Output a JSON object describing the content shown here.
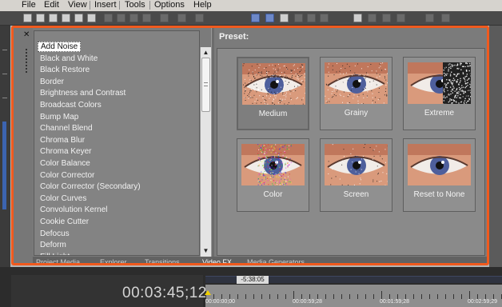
{
  "menu": [
    "File",
    "Edit",
    "View",
    "Insert",
    "Tools",
    "Options",
    "Help"
  ],
  "effects": [
    "Add Noise",
    "Black and White",
    "Black Restore",
    "Border",
    "Brightness and Contrast",
    "Broadcast Colors",
    "Bump Map",
    "Channel Blend",
    "Chroma Blur",
    "Chroma Keyer",
    "Color Balance",
    "Color Corrector",
    "Color Corrector (Secondary)",
    "Color Curves",
    "Convolution Kernel",
    "Cookie Cutter",
    "Defocus",
    "Deform",
    "Fill Light"
  ],
  "selected_effect": "Add Noise",
  "preset_title": "Preset:",
  "presets": [
    "Medium",
    "Grainy",
    "Extreme",
    "Color",
    "Screen",
    "Reset to None"
  ],
  "selected_preset": "Medium",
  "tabs": [
    "Project Media",
    "Explorer",
    "Transitions",
    "Video FX",
    "Media Generators"
  ],
  "active_tab": "Video FX",
  "timeline": {
    "timecode": "00:03:45;12",
    "region_marker": "-5:38:05",
    "ruler_labels": [
      "00:00:00;00",
      "00:00:59;28",
      "00:01:59;28",
      "00:02:59;29"
    ]
  },
  "colors": {
    "highlight": "#f05a1e",
    "panel": "#7b7b7b"
  },
  "icons": [
    "close-icon",
    "scroll-up-icon",
    "scroll-down-icon",
    "playhead-icon"
  ]
}
